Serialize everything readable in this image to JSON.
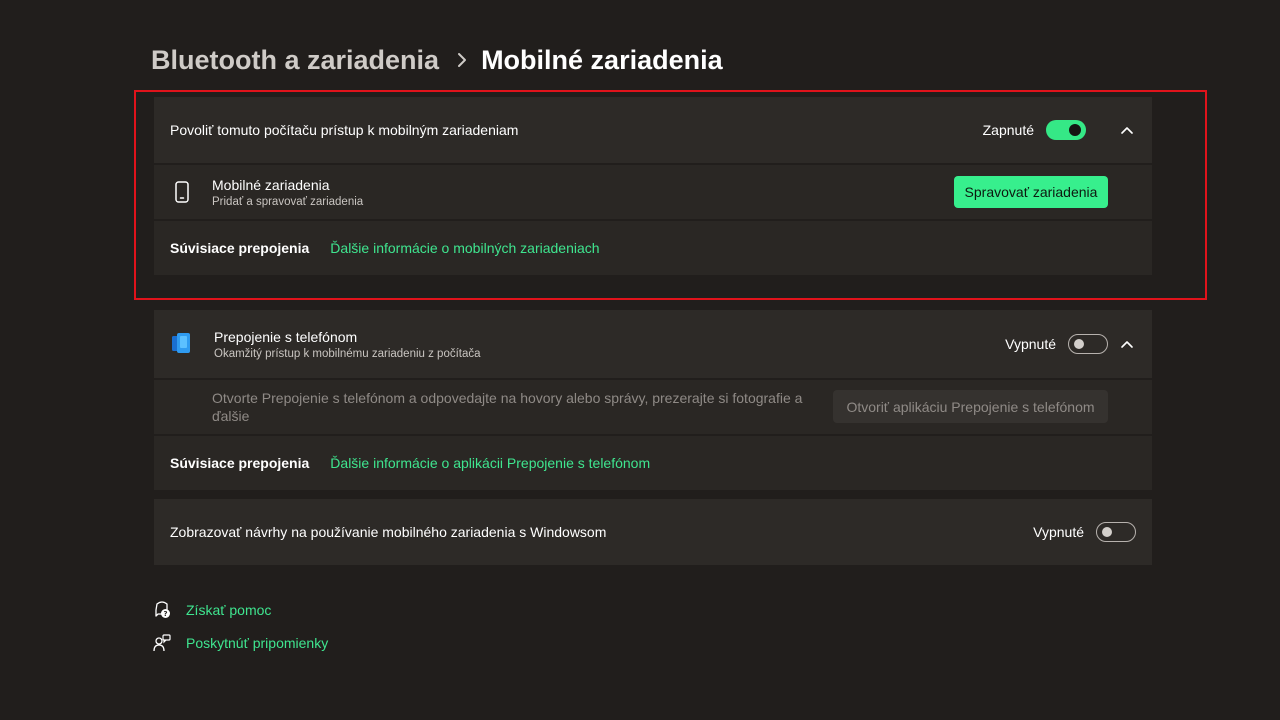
{
  "breadcrumb": {
    "parent": "Bluetooth a zariadenia",
    "separator": "›",
    "current": "Mobilné zariadenia"
  },
  "mobile_access": {
    "title": "Povoliť tomuto počítaču prístup k mobilným zariadeniam",
    "toggle_label": "Zapnuté",
    "toggle_on": true,
    "devices": {
      "icon": "phone-icon",
      "title": "Mobilné zariadenia",
      "subtitle": "Pridať a spravovať zariadenia",
      "button": "Spravovať zariadenia"
    },
    "related_label": "Súvisiace prepojenia",
    "related_link": "Ďalšie informácie o mobilných zariadeniach"
  },
  "phone_link": {
    "icon": "phone-link-app-icon",
    "title": "Prepojenie s telefónom",
    "subtitle": "Okamžitý prístup k mobilnému zariadeniu z počítača",
    "toggle_label": "Vypnuté",
    "toggle_on": false,
    "description": "Otvorte Prepojenie s telefónom a odpovedajte na hovory alebo správy, prezerajte si fotografie a ďalšie",
    "open_button": "Otvoriť aplikáciu Prepojenie s telefónom",
    "related_label": "Súvisiace prepojenia",
    "related_link": "Ďalšie informácie o aplikácii Prepojenie s telefónom"
  },
  "suggestions": {
    "title": "Zobrazovať návrhy na používanie mobilného zariadenia s Windowsom",
    "toggle_label": "Vypnuté",
    "toggle_on": false
  },
  "footer": {
    "help": "Získať pomoc",
    "feedback": "Poskytnúť pripomienky"
  },
  "colors": {
    "background": "#211e1c",
    "card": "#2d2a27",
    "accent": "#37ef8d",
    "highlight": "#e0131b"
  }
}
